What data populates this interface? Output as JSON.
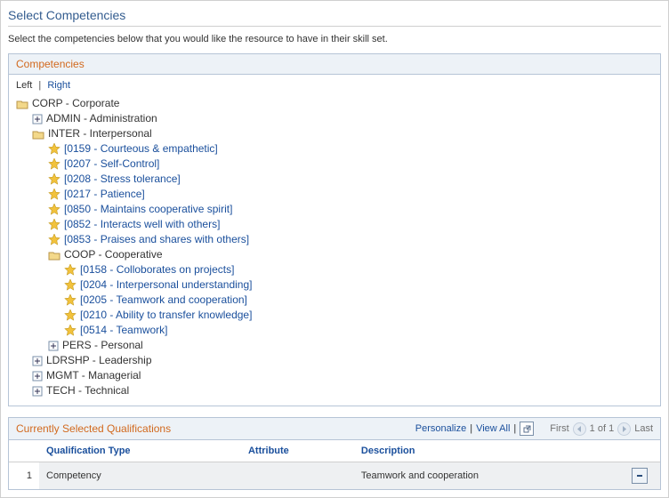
{
  "page_title": "Select Competencies",
  "instruction": "Select the competencies below that you would like the resource to have in their skill set.",
  "competencies_label": "Competencies",
  "align": {
    "left": "Left",
    "right": "Right",
    "sep": "|"
  },
  "tree": {
    "root": {
      "label": "CORP - Corporate",
      "type": "open"
    },
    "admin": {
      "label": "ADMIN - Administration"
    },
    "inter": {
      "label": "INTER - Interpersonal"
    },
    "inter_items": [
      "[0159 - Courteous & empathetic]",
      "[0207 - Self-Control]",
      "[0208 - Stress tolerance]",
      "[0217 - Patience]",
      "[0850 - Maintains cooperative spirit]",
      "[0852 - Interacts well with others]",
      "[0853 - Praises and shares with others]"
    ],
    "coop": {
      "label": "COOP - Cooperative"
    },
    "coop_items": [
      "[0158 - Colloborates on projects]",
      "[0204 - Interpersonal understanding]",
      "[0205 - Teamwork and cooperation]",
      "[0210 - Ability to transfer knowledge]",
      "[0514 - Teamwork]"
    ],
    "pers": {
      "label": "PERS - Personal"
    },
    "ldrshp": {
      "label": "LDRSHP - Leadership"
    },
    "mgmt": {
      "label": "MGMT - Managerial"
    },
    "tech": {
      "label": "TECH - Technical"
    }
  },
  "qual": {
    "title": "Currently Selected Qualifications",
    "personalize": "Personalize",
    "viewall": "View All",
    "first": "First",
    "last": "Last",
    "page": "1 of 1",
    "headers": {
      "type": "Qualification Type",
      "attr": "Attribute",
      "desc": "Description"
    },
    "rows": [
      {
        "idx": "1",
        "type": "Competency",
        "attr": "",
        "desc": "Teamwork and cooperation"
      }
    ]
  }
}
